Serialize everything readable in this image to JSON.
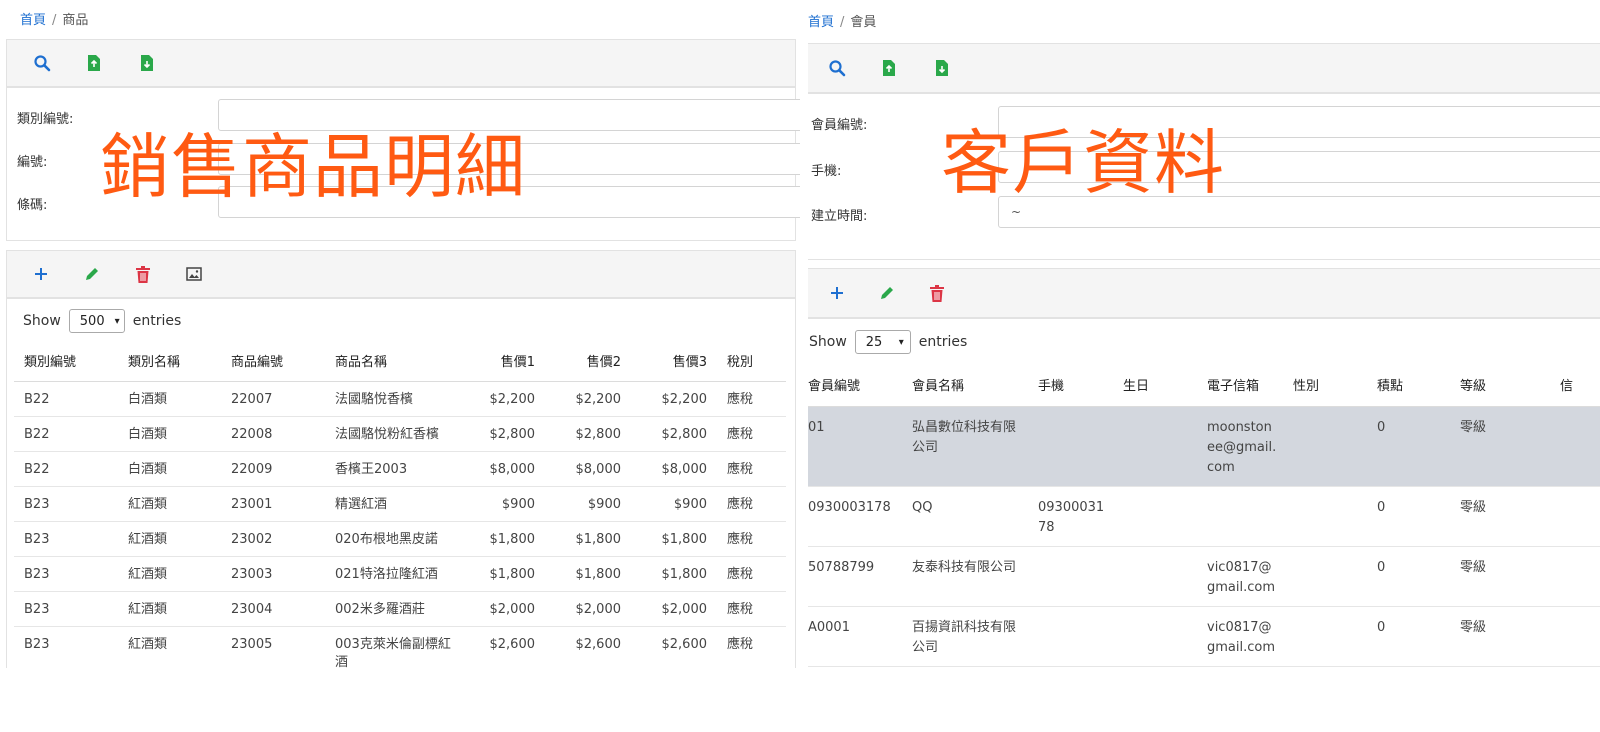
{
  "products": {
    "breadcrumb": {
      "home": "首頁",
      "separator": "/",
      "current": "商品"
    },
    "overlay_title": "銷售商品明細",
    "search_fields": [
      {
        "label": "類別編號:",
        "value": ""
      },
      {
        "label": "編號:",
        "value": ""
      },
      {
        "label": "條碼:",
        "value": ""
      }
    ],
    "show_label": "Show",
    "entries_label": "entries",
    "page_size": "500",
    "columns": [
      "類別編號",
      "類別名稱",
      "商品編號",
      "商品名稱",
      "售價1",
      "售價2",
      "售價3",
      "稅別"
    ],
    "rows": [
      [
        "B22",
        "白酒類",
        "22007",
        "法國駱悅香檳",
        "$2,200",
        "$2,200",
        "$2,200",
        "應稅"
      ],
      [
        "B22",
        "白酒類",
        "22008",
        "法國駱悅粉紅香檳",
        "$2,800",
        "$2,800",
        "$2,800",
        "應稅"
      ],
      [
        "B22",
        "白酒類",
        "22009",
        "香檳王2003",
        "$8,000",
        "$8,000",
        "$8,000",
        "應稅"
      ],
      [
        "B23",
        "紅酒類",
        "23001",
        "精選紅酒",
        "$900",
        "$900",
        "$900",
        "應稅"
      ],
      [
        "B23",
        "紅酒類",
        "23002",
        "020布根地黑皮諾",
        "$1,800",
        "$1,800",
        "$1,800",
        "應稅"
      ],
      [
        "B23",
        "紅酒類",
        "23003",
        "021特洛拉隆紅酒",
        "$1,800",
        "$1,800",
        "$1,800",
        "應稅"
      ],
      [
        "B23",
        "紅酒類",
        "23004",
        "002米多羅酒莊",
        "$2,000",
        "$2,000",
        "$2,000",
        "應稅"
      ],
      [
        "B23",
        "紅酒類",
        "23005",
        "003克萊米倫副標紅酒",
        "$2,600",
        "$2,600",
        "$2,600",
        "應稅"
      ]
    ]
  },
  "members": {
    "breadcrumb": {
      "home": "首頁",
      "separator": "/",
      "current": "會員"
    },
    "overlay_title": "客戶資料",
    "search_fields": [
      {
        "label": "會員編號:",
        "value": ""
      },
      {
        "label": "手機:",
        "value": ""
      },
      {
        "label": "建立時間:",
        "value": "~"
      }
    ],
    "show_label": "Show",
    "entries_label": "entries",
    "page_size": "25",
    "columns": [
      "會員編號",
      "會員名稱",
      "手機",
      "生日",
      "電子信箱",
      "性別",
      "積點",
      "等級",
      "信"
    ],
    "rows": [
      [
        "01",
        "弘昌數位科技有限公司",
        "",
        "",
        "moonstonee@gmail.com",
        "",
        "0",
        "零級",
        ""
      ],
      [
        "0930003178",
        "QQ",
        "0930003178",
        "",
        "",
        "",
        "0",
        "零級",
        ""
      ],
      [
        "50788799",
        "友泰科技有限公司",
        "",
        "",
        "vic0817@gmail.com",
        "",
        "0",
        "零級",
        ""
      ],
      [
        "A0001",
        "百揚資訊科技有限公司",
        "",
        "",
        "vic0817@gmail.com",
        "",
        "0",
        "零級",
        ""
      ]
    ],
    "selected_row": 0
  },
  "colors": {
    "link": "#1e6fd0",
    "overlay": "#ff5a12",
    "add": "#1e6fd0",
    "edit": "#2aa84a",
    "delete": "#dc3545",
    "selected_row": "#d3d7de"
  }
}
